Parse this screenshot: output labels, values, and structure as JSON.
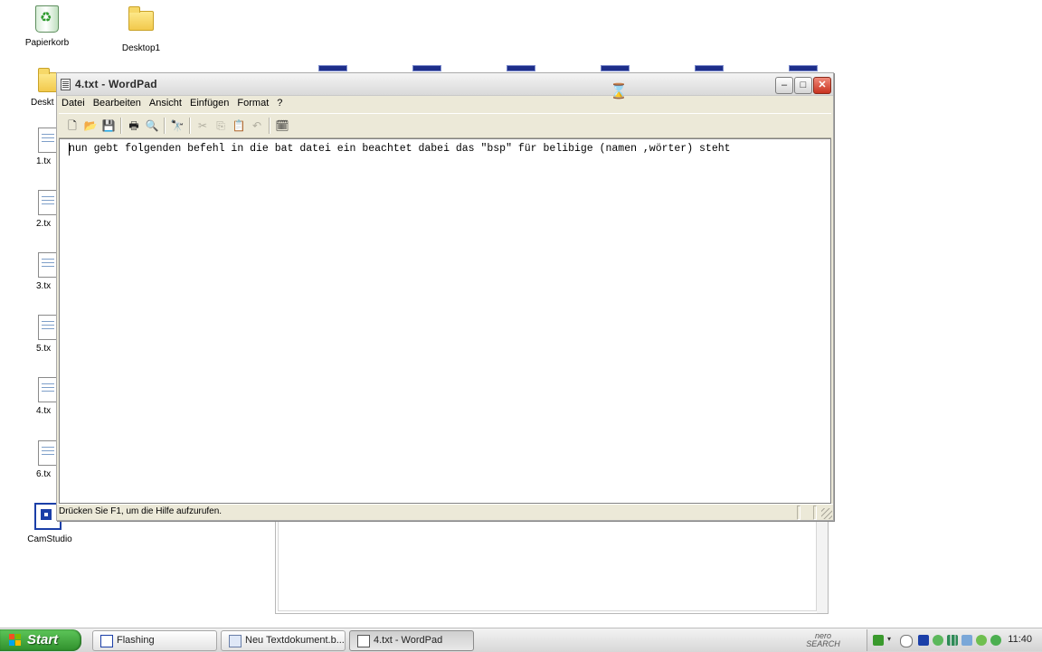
{
  "desktop": {
    "icons": [
      {
        "label": "Papierkorb"
      },
      {
        "label": "Desktop1"
      }
    ],
    "side_icons": [
      {
        "label": "Deskt"
      },
      {
        "label": "1.tx"
      },
      {
        "label": "2.tx"
      },
      {
        "label": "3.tx"
      },
      {
        "label": "5.tx"
      },
      {
        "label": "4.tx"
      },
      {
        "label": "6.tx"
      },
      {
        "label": "CamStudio"
      }
    ]
  },
  "window": {
    "title": "4.txt - WordPad",
    "controls": {
      "minimize": "–",
      "maximize": "□",
      "close": "✕"
    },
    "menu": [
      "Datei",
      "Bearbeiten",
      "Ansicht",
      "Einfügen",
      "Format",
      "?"
    ],
    "toolbar_icons": [
      "new-icon",
      "open-icon",
      "save-icon",
      "print-icon",
      "print-preview-icon",
      "find-icon",
      "cut-icon",
      "copy-icon",
      "paste-icon",
      "undo-icon",
      "insert-datetime-icon"
    ],
    "document_text": "nun gebt folgenden befehl in die bat datei ein beachtet dabei das \"bsp\" für belibige (namen ,wörter) steht",
    "status_text": "Drücken Sie F1, um die Hilfe aufzurufen."
  },
  "taskbar": {
    "start_label": "Start",
    "tasks": [
      {
        "label": "Flashing"
      },
      {
        "label": "Neu Textdokument.b..."
      },
      {
        "label": "4.txt - WordPad"
      }
    ],
    "nero_label_1": "nero",
    "nero_label_2": "SEARCH",
    "clock": "11:40"
  }
}
